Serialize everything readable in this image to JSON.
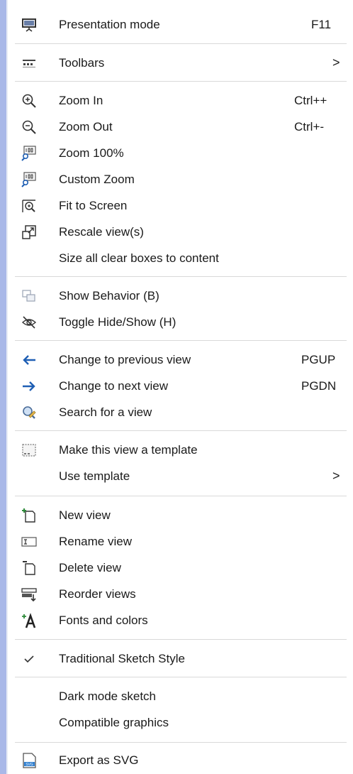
{
  "menu": {
    "presentation": {
      "label": "Presentation mode",
      "shortcut": "F11",
      "icon": "presentation-icon"
    },
    "toolbars": {
      "label": "Toolbars",
      "submenu": ">",
      "icon": "toolbars-icon"
    },
    "zoom_in": {
      "label": "Zoom In",
      "shortcut": "Ctrl++",
      "icon": "zoom-in-icon"
    },
    "zoom_out": {
      "label": "Zoom Out",
      "shortcut": "Ctrl+-",
      "icon": "zoom-out-icon"
    },
    "zoom_100": {
      "label": "Zoom 100%",
      "icon": "zoom-100-icon"
    },
    "custom_zoom": {
      "label": "Custom Zoom",
      "icon": "custom-zoom-icon"
    },
    "fit_screen": {
      "label": "Fit to Screen",
      "icon": "fit-to-screen-icon"
    },
    "rescale": {
      "label": "Rescale view(s)",
      "icon": "rescale-icon"
    },
    "size_boxes": {
      "label": "Size all clear boxes to content"
    },
    "show_behavior": {
      "label": "Show Behavior (B)",
      "icon": "show-behavior-icon"
    },
    "toggle_hide": {
      "label": "Toggle Hide/Show (H)",
      "icon": "hide-show-icon"
    },
    "prev_view": {
      "label": "Change to previous view",
      "shortcut": "PGUP",
      "icon": "arrow-left-icon"
    },
    "next_view": {
      "label": "Change to next view",
      "shortcut": "PGDN",
      "icon": "arrow-right-icon"
    },
    "search_view": {
      "label": "Search for a view",
      "icon": "search-view-icon"
    },
    "make_template": {
      "label": "Make this view a template",
      "icon": "template-icon"
    },
    "use_template": {
      "label": "Use template",
      "submenu": ">"
    },
    "new_view": {
      "label": "New view",
      "icon": "new-view-icon"
    },
    "rename_view": {
      "label": "Rename view",
      "icon": "rename-view-icon"
    },
    "delete_view": {
      "label": "Delete view",
      "icon": "delete-view-icon"
    },
    "reorder_views": {
      "label": "Reorder views",
      "icon": "reorder-views-icon"
    },
    "fonts_colors": {
      "label": "Fonts and colors",
      "icon": "fonts-icon"
    },
    "traditional": {
      "label": "Traditional Sketch Style",
      "checked": true,
      "icon": "checkmark-icon"
    },
    "dark_mode": {
      "label": "Dark mode sketch"
    },
    "compatible": {
      "label": "Compatible graphics"
    },
    "export_svg": {
      "label": "Export as SVG",
      "icon": "export-svg-icon",
      "icon_text": "SVG"
    }
  },
  "colors": {
    "frame": "#a9b8e8",
    "separator": "#d9d9d9",
    "arrow_blue": "#1f5fb4"
  }
}
